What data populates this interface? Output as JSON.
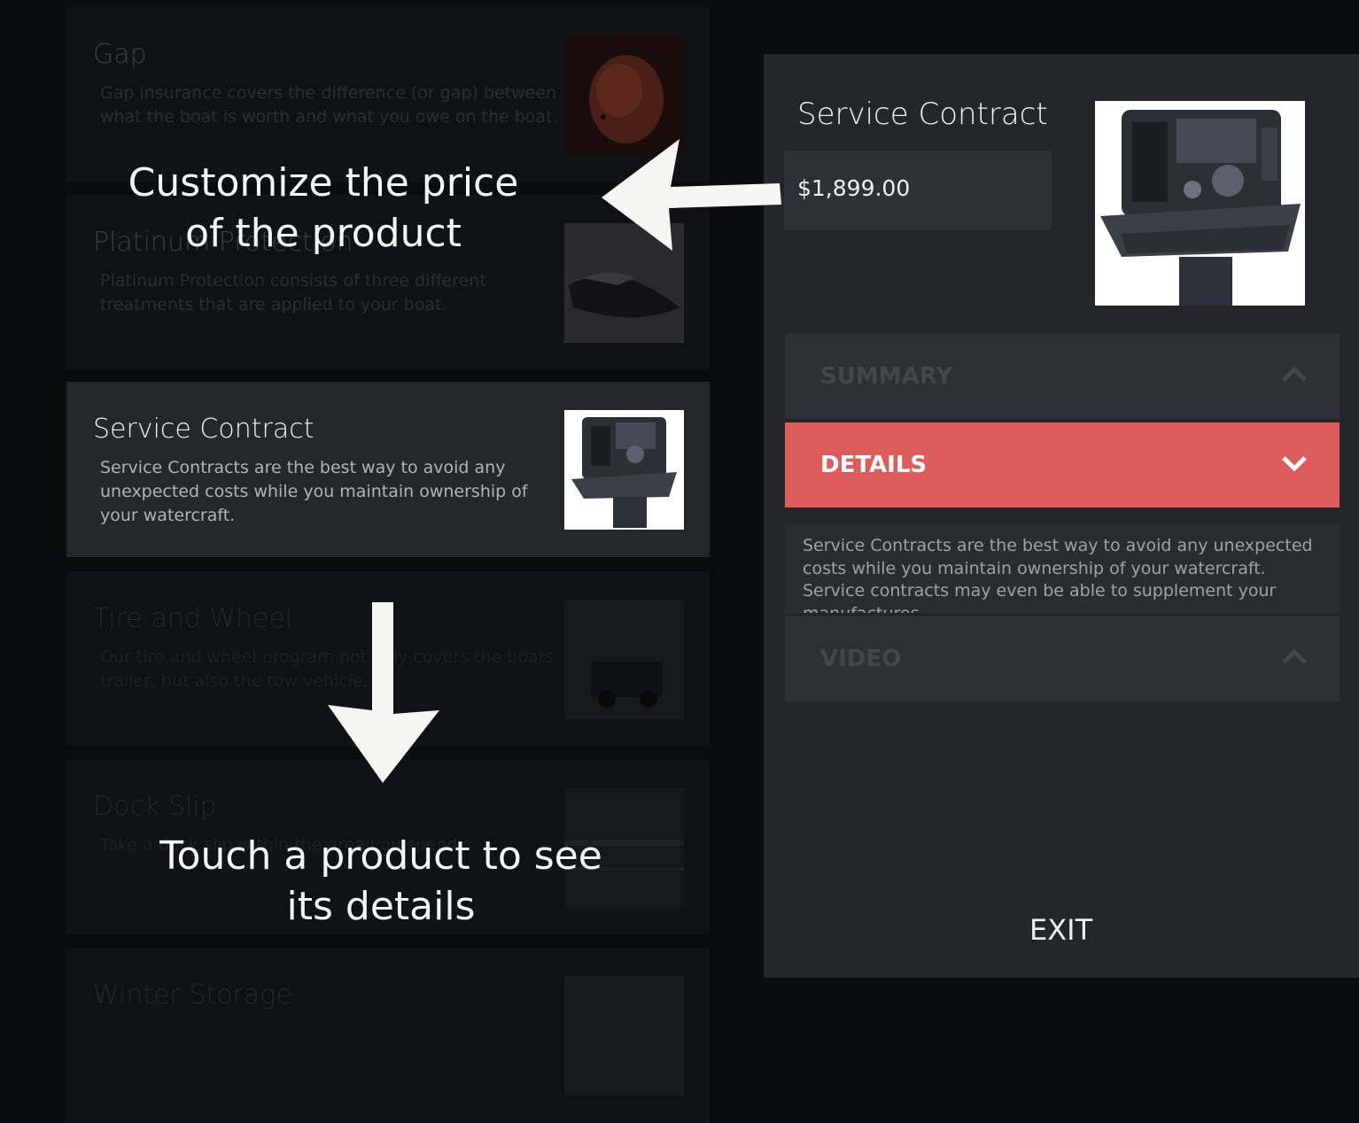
{
  "products": [
    {
      "title": "Gap",
      "description": "Gap insurance covers the difference (or gap) between what the boat is worth and what you owe on the boat.",
      "image": "piggy-bank-image"
    },
    {
      "title": "Platinum Protection",
      "description": "Platinum Protection consists of three different treatments that are applied to your boat.",
      "image": "boat-image"
    },
    {
      "title": "Service Contract",
      "description": "Service Contracts are the best way to avoid any unexpected costs while you maintain ownership of your watercraft.",
      "image": "outboard-engine-image"
    },
    {
      "title": "Tire and Wheel",
      "description": "Our tire and wheel program not only covers the boats trailer, but also the tow vehicle.",
      "image": "truck-image"
    },
    {
      "title": "Dock Slip",
      "description": "Take a dock slip within the area you spend",
      "image": "marina-image"
    },
    {
      "title": "Winter Storage",
      "description": "",
      "image": "storage-image"
    }
  ],
  "detail": {
    "title": "Service Contract",
    "price": "$1,899.00",
    "sections": {
      "summary": "SUMMARY",
      "details": "DETAILS",
      "video": "VIDEO"
    },
    "details_text": "Service Contracts are the best way to avoid any unexpected costs while you maintain ownership of your watercraft.  Service contracts may even be able to supplement your manufactures",
    "exit_label": "EXIT"
  },
  "hints": {
    "price_hint": "Customize the price of the product",
    "touch_hint": "Touch a product to see its details"
  },
  "colors": {
    "accent": "#df5c5c",
    "panel": "#24262c",
    "background": "#0b0c0e"
  }
}
